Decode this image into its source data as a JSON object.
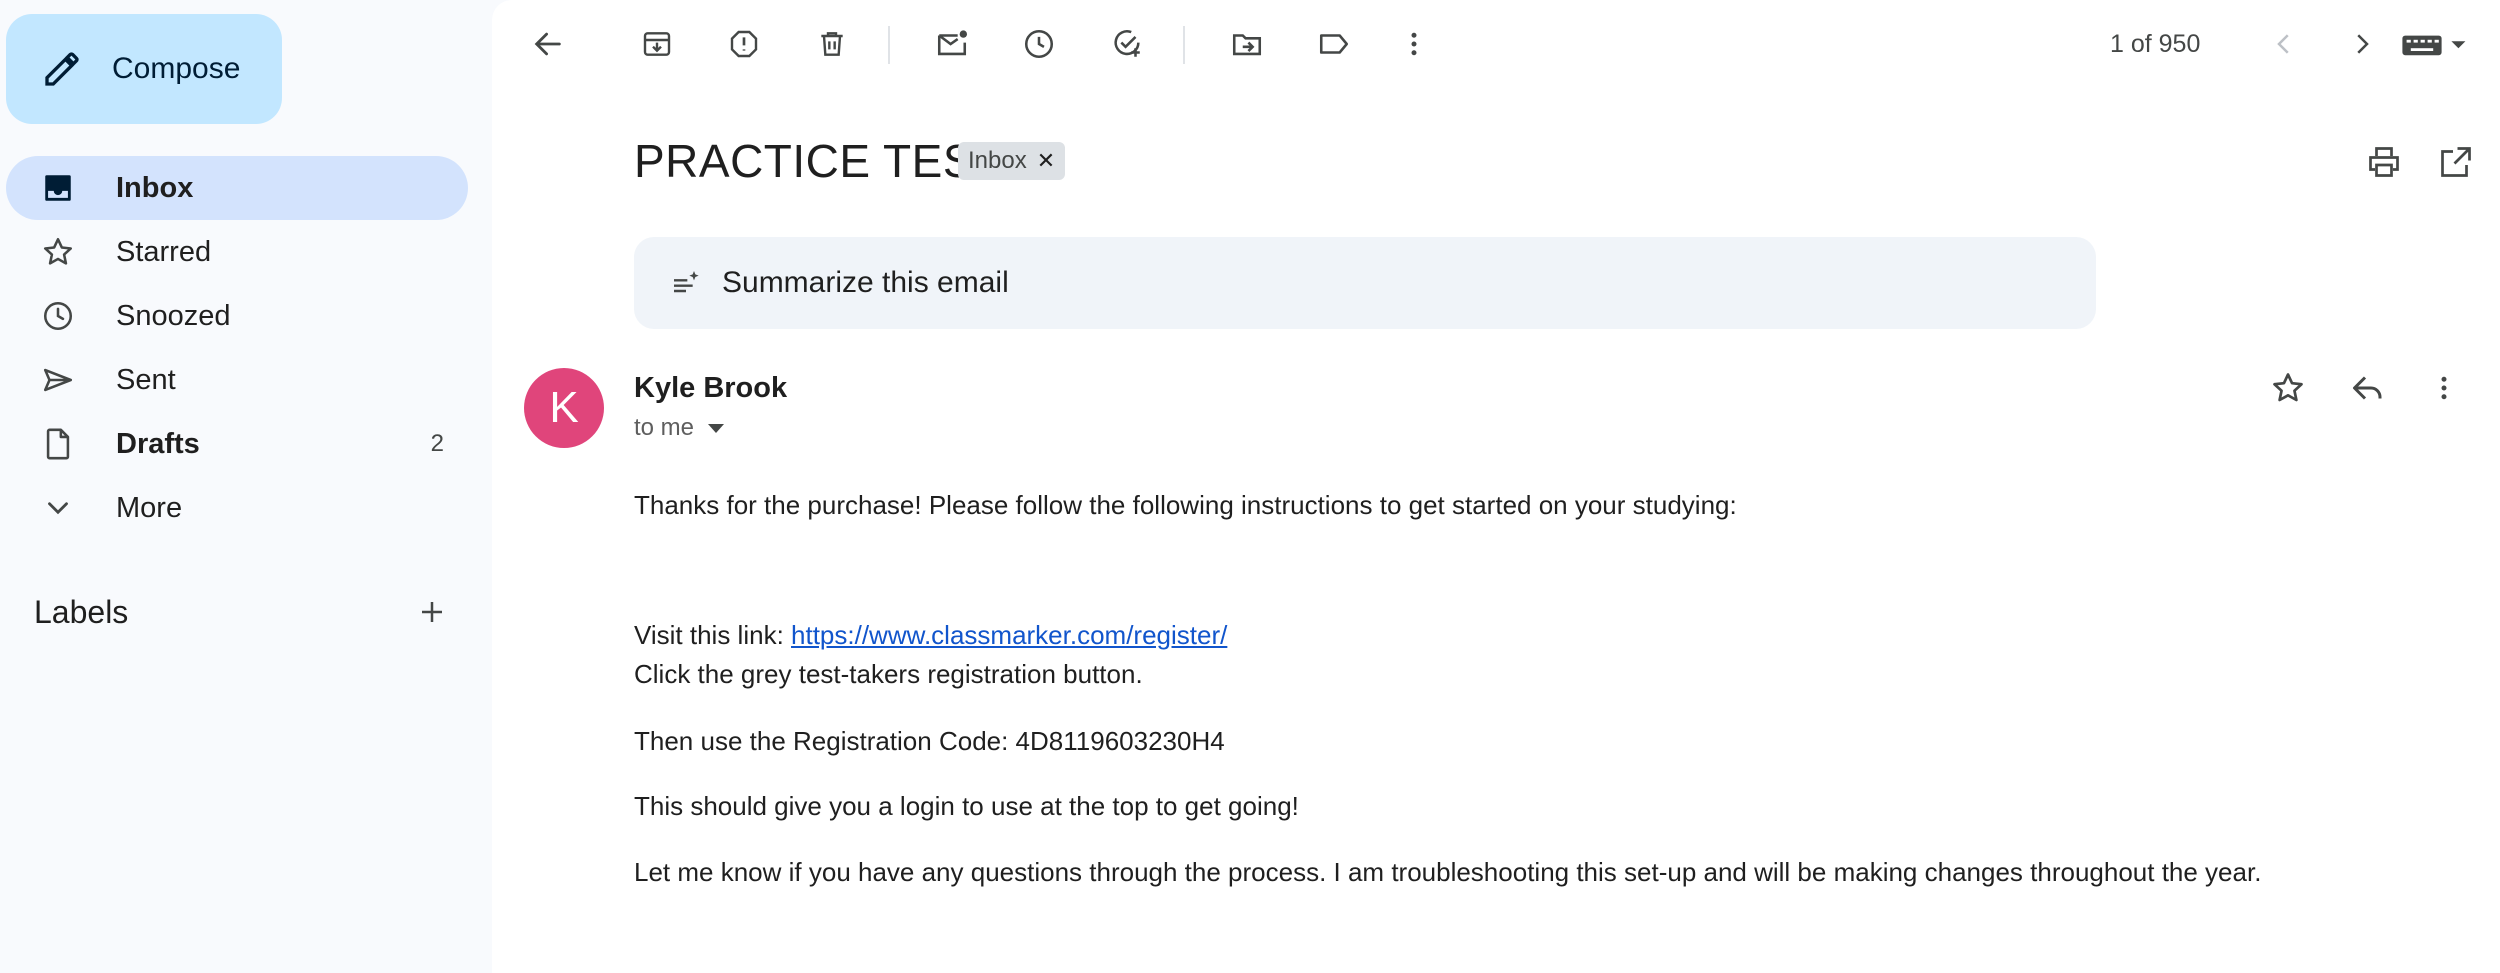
{
  "sidebar": {
    "compose_label": "Compose",
    "items": [
      {
        "label": "Inbox",
        "icon": "inbox-icon"
      },
      {
        "label": "Starred",
        "icon": "star-icon"
      },
      {
        "label": "Snoozed",
        "icon": "clock-icon"
      },
      {
        "label": "Sent",
        "icon": "send-icon"
      },
      {
        "label": "Drafts",
        "icon": "draft-icon",
        "count": "2"
      },
      {
        "label": "More",
        "icon": "chevron-down-icon"
      }
    ],
    "labels_heading": "Labels"
  },
  "toolbar": {
    "pager": "1 of 950"
  },
  "email": {
    "subject": "PRACTICE TEST",
    "tag": "Inbox",
    "summarize_label": "Summarize this email",
    "avatar_letter": "K",
    "sender": "Kyle Brook",
    "recipient": "to me",
    "body": {
      "line1": "Thanks for the purchase! Please follow the following instructions to get started on your studying:",
      "visit_prefix": "Visit this link: ",
      "link": "https://www.classmarker.com/register/",
      "line3": "Click the grey test-takers registration button.",
      "line4": "Then use the Registration Code: 4D8119603230H4",
      "line5": "This should give you a login to use at the top to get going!",
      "line6": "Let me know if you have any questions through the process. I am troubleshooting this set-up and will be making changes throughout the year."
    }
  },
  "colors": {
    "compose_bg": "#c2e7ff",
    "active_nav_bg": "#d3e3fd",
    "avatar_bg": "#e0457b",
    "link": "#1155cc"
  }
}
